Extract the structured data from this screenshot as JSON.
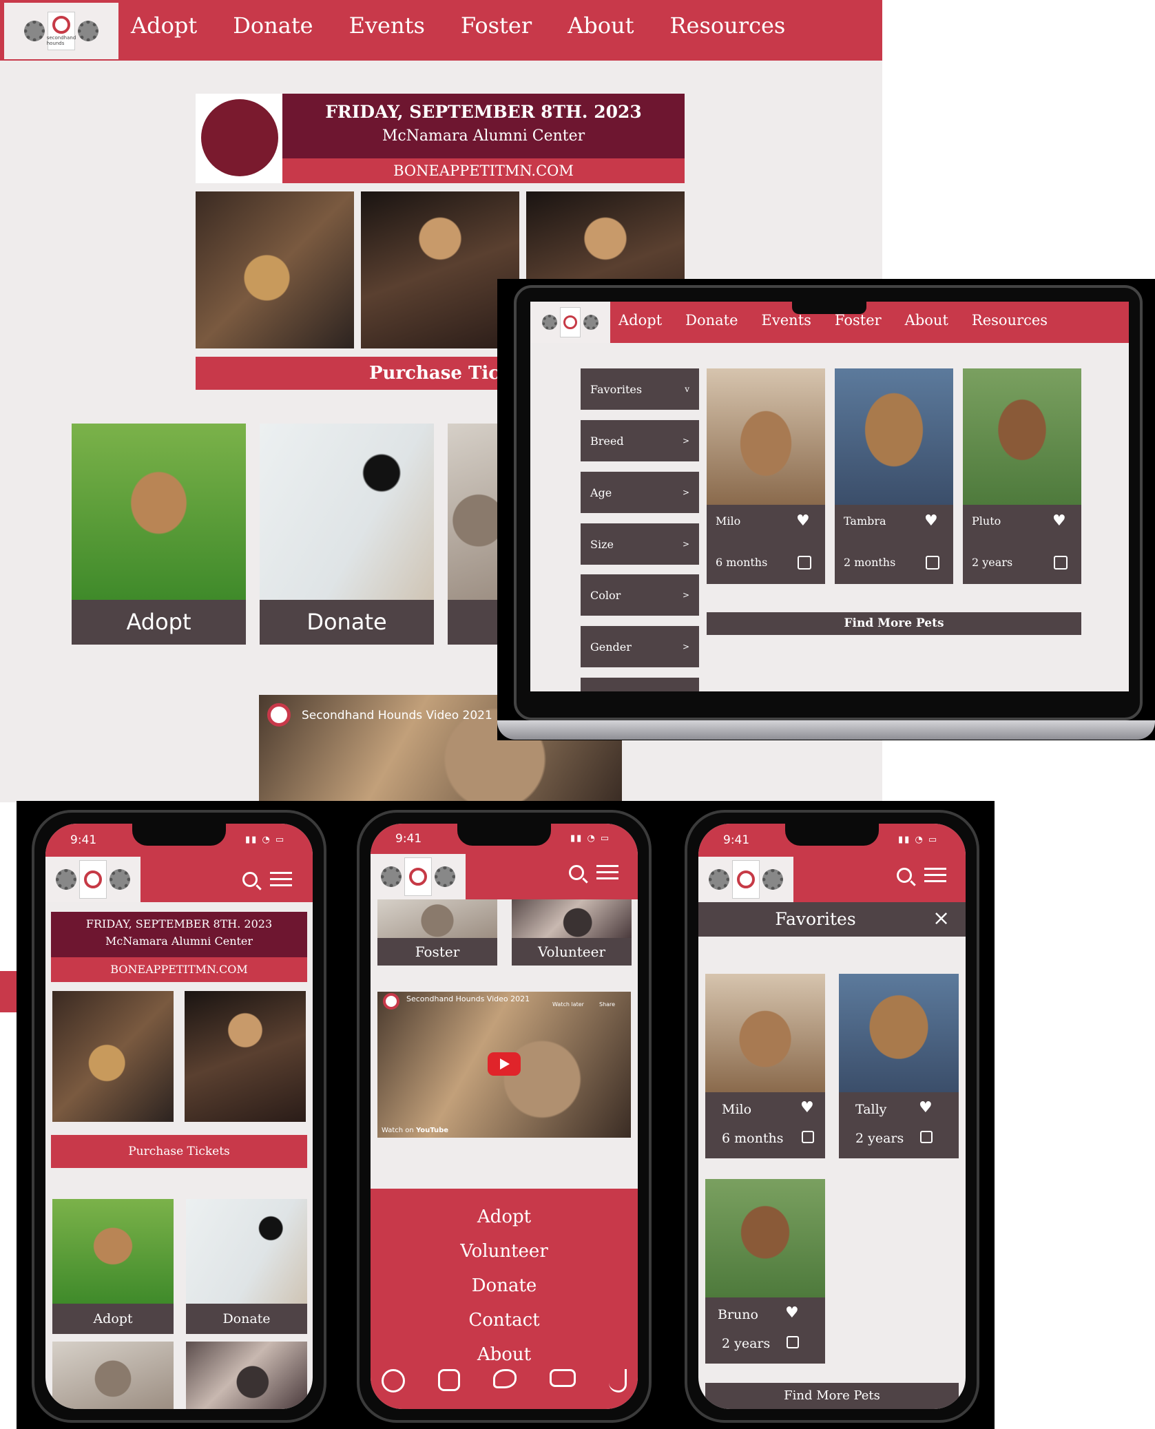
{
  "nav": {
    "items": [
      "Adopt",
      "Donate",
      "Events",
      "Foster",
      "About",
      "Resources"
    ]
  },
  "event": {
    "date": "FRIDAY, SEPTEMBER 8TH. 2023",
    "venue": "McNamara Alumni Center",
    "url": "BONEAPPETITMN.COM",
    "purchase": "Purchase Tickets",
    "purchase_truncated": "Purchase Ticke"
  },
  "tiles": {
    "adopt": "Adopt",
    "donate": "Donate",
    "foster": "Foster",
    "volunteer": "Volunteer"
  },
  "video": {
    "title": "Secondhand Hounds Video 2021",
    "watch_later": "Watch later",
    "share": "Share",
    "watch_on": "Watch on",
    "youtube": "YouTube"
  },
  "filters": {
    "items": [
      {
        "label": "Favorites",
        "chevron": "v"
      },
      {
        "label": "Breed",
        "chevron": ">"
      },
      {
        "label": "Age",
        "chevron": ">"
      },
      {
        "label": "Size",
        "chevron": ">"
      },
      {
        "label": "Color",
        "chevron": ">"
      },
      {
        "label": "Gender",
        "chevron": ">"
      }
    ]
  },
  "laptop_pets": [
    {
      "name": "Milo",
      "age": "6 months"
    },
    {
      "name": "Tambra",
      "age": "2 months"
    },
    {
      "name": "Pluto",
      "age": "2 years"
    }
  ],
  "find_more": "Find More Pets",
  "phone": {
    "time": "9:41",
    "favorites_title": "Favorites",
    "close": "×"
  },
  "phone_pets": [
    {
      "name": "Milo",
      "age": "6 months"
    },
    {
      "name": "Tally",
      "age": "2 years"
    },
    {
      "name": "Bruno",
      "age": "2 years"
    }
  ],
  "menu": {
    "items": [
      "Adopt",
      "Volunteer",
      "Donate",
      "Contact",
      "About"
    ]
  },
  "logo": {
    "text": "secondhand hounds"
  }
}
